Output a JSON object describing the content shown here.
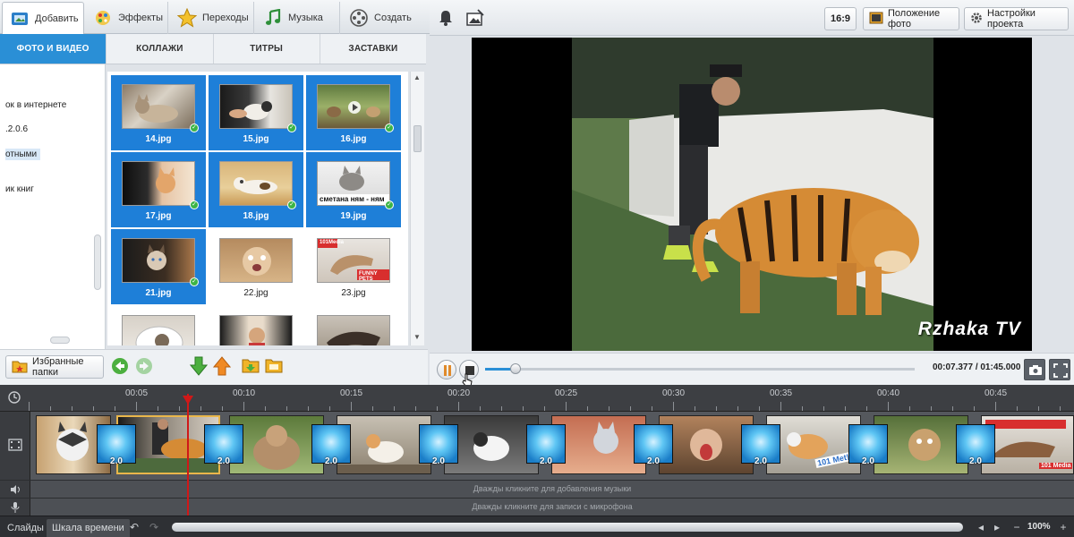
{
  "tabs": [
    {
      "label": "Добавить",
      "icon": "add-media-icon"
    },
    {
      "label": "Эффекты",
      "icon": "effects-palette-icon"
    },
    {
      "label": "Переходы",
      "icon": "transitions-star-icon"
    },
    {
      "label": "Музыка",
      "icon": "music-note-icon"
    },
    {
      "label": "Создать",
      "icon": "create-film-icon"
    }
  ],
  "right_toolbar": {
    "aspect": "16:9",
    "photo_position": "Положение фото",
    "project_settings": "Настройки проекта"
  },
  "subtabs": [
    "ФОТО И ВИДЕО",
    "КОЛЛАЖИ",
    "ТИТРЫ",
    "ЗАСТАВКИ"
  ],
  "tree": {
    "items": [
      "ок в интернете",
      ".2.0.6",
      "отными",
      "ик книг"
    ]
  },
  "grid": {
    "items": [
      {
        "name": "14.jpg",
        "selected": true
      },
      {
        "name": "15.jpg",
        "selected": true
      },
      {
        "name": "16.jpg",
        "selected": true
      },
      {
        "name": "17.jpg",
        "selected": true
      },
      {
        "name": "18.jpg",
        "selected": true
      },
      {
        "name": "19.jpg",
        "selected": true
      },
      {
        "name": "21.jpg",
        "selected": true
      },
      {
        "name": "22.jpg",
        "selected": false
      },
      {
        "name": "23.jpg",
        "selected": false
      },
      {
        "name": "",
        "selected": false
      },
      {
        "name": "",
        "selected": false
      },
      {
        "name": "",
        "selected": false
      }
    ],
    "thumb_overlays": {
      "19": "сметана ням - ням",
      "23": "FUNNY PETS",
      "23b": "101Media"
    }
  },
  "left_toolbar": {
    "favorites": "Избранные папки"
  },
  "preview": {
    "watermark": "Rzhaka TV"
  },
  "player": {
    "progress": 0.071,
    "time": "00:07.377 / 01:45.000"
  },
  "timeline": {
    "ticks": [
      "00:05",
      "00:10",
      "00:15",
      "00:20",
      "00:25",
      "00:30",
      "00:35",
      "00:40",
      "00:45"
    ],
    "transition_duration": "2.0",
    "music_hint": "Дважды кликните для добавления музыки",
    "mic_hint": "Дважды кликните для записи с микрофона",
    "clip_label_last": "101 Media",
    "clip_label_meme": "101 Met!"
  },
  "statusbar": {
    "slides": "Слайды",
    "timeline": "Шкала времени",
    "zoom": "100%"
  },
  "colors": {
    "accent": "#2a8fd6",
    "selection": "#1e7fd8",
    "playhead": "#d01818",
    "timeline_bg": "#55585d"
  }
}
